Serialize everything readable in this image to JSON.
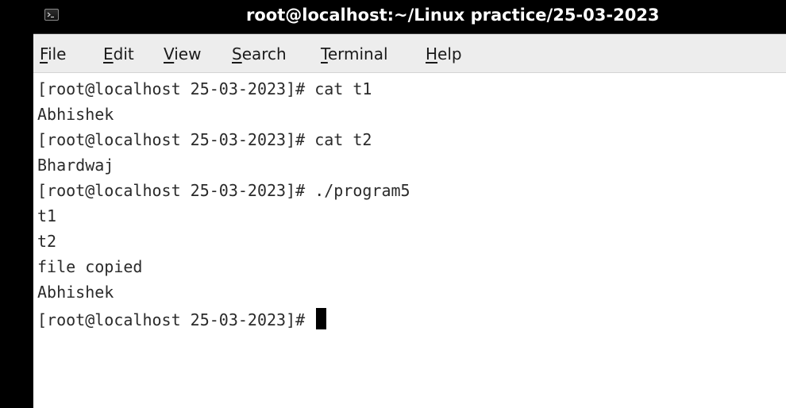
{
  "window": {
    "title": "root@localhost:~/Linux practice/25-03-2023",
    "app_icon": "terminal-icon"
  },
  "menu": {
    "items": [
      {
        "mnemonic": "F",
        "rest": "ile"
      },
      {
        "mnemonic": "E",
        "rest": "dit"
      },
      {
        "mnemonic": "V",
        "rest": "iew"
      },
      {
        "mnemonic": "S",
        "rest": "earch"
      },
      {
        "mnemonic": "T",
        "rest": "erminal"
      },
      {
        "mnemonic": "H",
        "rest": "elp"
      }
    ]
  },
  "terminal": {
    "lines": [
      "[root@localhost 25-03-2023]# cat t1",
      "Abhishek",
      "[root@localhost 25-03-2023]# cat t2",
      "Bhardwaj",
      "[root@localhost 25-03-2023]# ./program5",
      "t1",
      "t2",
      "file copied",
      "Abhishek"
    ],
    "prompt": "[root@localhost 25-03-2023]# "
  },
  "colors": {
    "titlebar_bg": "#000000",
    "menubar_bg": "#ededed",
    "terminal_bg": "#ffffff",
    "terminal_fg": "#2a2a2a"
  }
}
